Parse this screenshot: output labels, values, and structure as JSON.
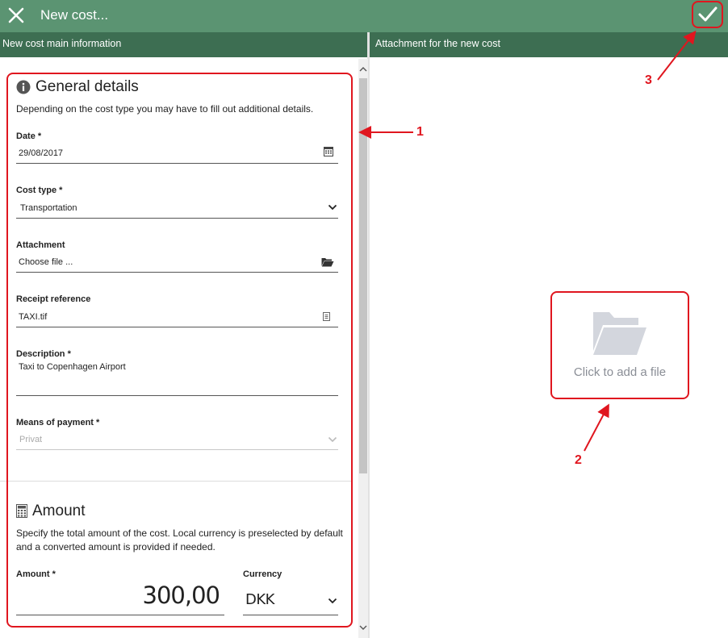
{
  "window": {
    "title": "New cost...",
    "close_icon": "close-icon",
    "save_icon": "checkmark-icon"
  },
  "panels": {
    "left_header": "New cost main information",
    "right_header": "Attachment for the new cost"
  },
  "general": {
    "title": "General details",
    "icon": "info-icon",
    "help": "Depending on the cost type you may have to fill out additional details.",
    "fields": {
      "date": {
        "label": "Date *",
        "value": "29/08/2017",
        "icon": "calendar-icon"
      },
      "cost_type": {
        "label": "Cost type *",
        "value": "Transportation",
        "icon": "chevron-down-icon"
      },
      "attachment": {
        "label": "Attachment",
        "value": "Choose file ...",
        "icon": "folder-open-icon"
      },
      "receipt": {
        "label": "Receipt reference",
        "value": "TAXI.tif",
        "icon": "document-icon"
      },
      "description": {
        "label": "Description *",
        "value": "Taxi to Copenhagen Airport"
      },
      "payment": {
        "label": "Means of payment *",
        "value": "Privat",
        "icon": "chevron-down-icon",
        "disabled": true
      }
    }
  },
  "amount": {
    "title": "Amount",
    "icon": "calculator-icon",
    "help": "Specify the total amount of the cost. Local currency is preselected by default and a converted amount is provided if needed.",
    "amount_label": "Amount *",
    "amount_value": "300,00",
    "currency_label": "Currency",
    "currency_value": "DKK"
  },
  "dropzone": {
    "text": "Click to add a file",
    "icon": "folder-icon"
  },
  "annotations": [
    "1",
    "2",
    "3"
  ],
  "colors": {
    "topbar": "#5b9472",
    "subheader": "#3d6e52",
    "annotation": "#e0161f",
    "dropzone_icon": "#d3d6dd"
  }
}
